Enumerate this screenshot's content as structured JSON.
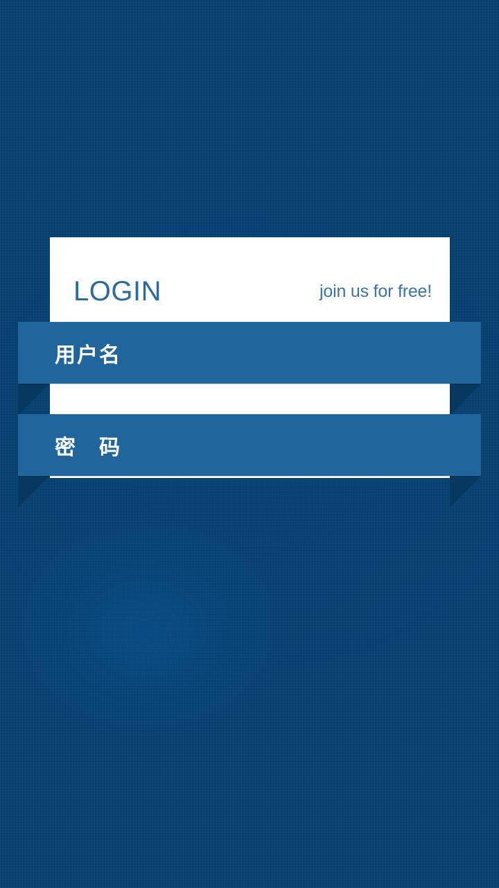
{
  "login": {
    "title": "LOGIN",
    "join_link": "join us for free!"
  },
  "username": {
    "label": "用户名",
    "value": ""
  },
  "password": {
    "label": "密　码",
    "value": ""
  },
  "colors": {
    "background": "#06406f",
    "ribbon": "#20659b",
    "card": "#ffffff",
    "title": "#2a6aa0",
    "fold_shadow": "#07385f"
  }
}
